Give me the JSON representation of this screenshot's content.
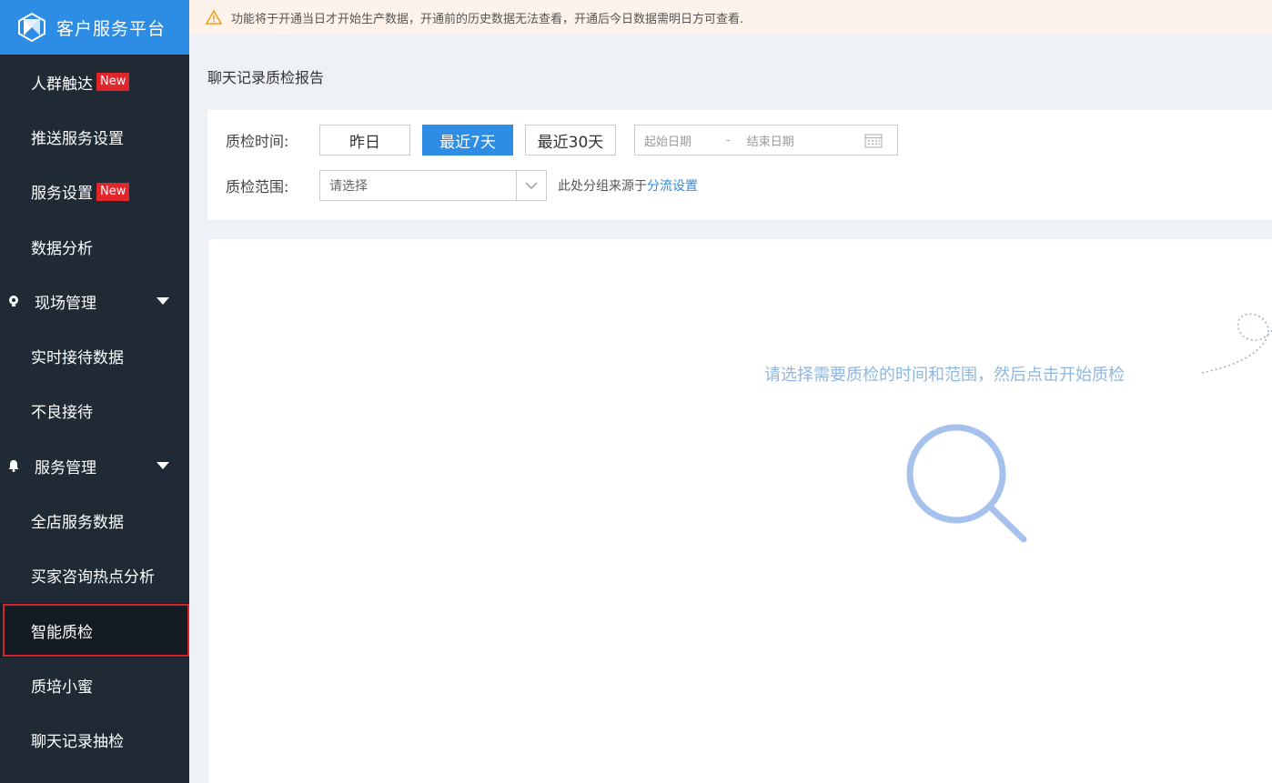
{
  "brand": {
    "title": "客户服务平台"
  },
  "notice": {
    "text": "功能将于开通当日才开始生产数据，开通前的历史数据无法查看，开通后今日数据需明日方可查看."
  },
  "sidebar": {
    "items": [
      {
        "label": "人群触达",
        "badge": "New"
      },
      {
        "label": "推送服务设置"
      },
      {
        "label": "服务设置",
        "badge": "New"
      },
      {
        "label": "数据分析"
      },
      {
        "label": "现场管理",
        "icon": "location-icon"
      },
      {
        "label": "实时接待数据"
      },
      {
        "label": "不良接待"
      },
      {
        "label": "服务管理",
        "icon": "bell-icon"
      },
      {
        "label": "全店服务数据"
      },
      {
        "label": "买家咨询热点分析"
      },
      {
        "label": "智能质检",
        "active": true
      },
      {
        "label": "质培小蜜"
      },
      {
        "label": "聊天记录抽检"
      }
    ]
  },
  "page": {
    "title": "聊天记录质检报告"
  },
  "filters": {
    "time_label": "质检时间:",
    "buttons": [
      "昨日",
      "最近7天",
      "最近30天"
    ],
    "selected": "最近7天",
    "start_placeholder": "起始日期",
    "separator": "-",
    "end_placeholder": "结束日期",
    "scope_label": "质检范围:",
    "scope_placeholder": "请选择",
    "hint_text": "此处分组来源于",
    "hint_link": "分流设置"
  },
  "content": {
    "empty_text": "请选择需要质检的时间和范围，然后点击开始质检"
  },
  "colors": {
    "primary": "#2d8ce3",
    "sidebar_bg": "#1f2a35",
    "badge": "#e0262a",
    "notice_bg": "#fdf3ea",
    "illustration": "#a6c1ee"
  }
}
